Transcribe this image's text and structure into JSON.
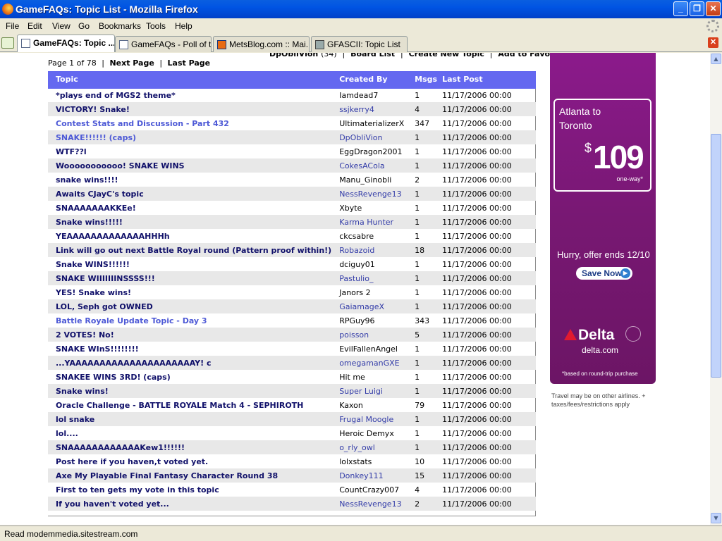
{
  "window": {
    "title": "GameFAQs: Topic List - Mozilla Firefox"
  },
  "menu": [
    "File",
    "Edit",
    "View",
    "Go",
    "Bookmarks",
    "Tools",
    "Help"
  ],
  "tabs": [
    {
      "label": "GameFAQs: Topic ...",
      "active": true
    },
    {
      "label": "GameFAQs - Poll of t...",
      "active": false
    },
    {
      "label": "MetsBlog.com :: Mai...",
      "active": false
    },
    {
      "label": "GFASCII: Topic List",
      "active": false
    }
  ],
  "top_nav": {
    "user": "DpObliVion",
    "karma": "(34)",
    "board_list": "Board List",
    "create_topic": "Create New Topic",
    "favorites": "Add to Favorites"
  },
  "pagination": {
    "page_text": "Page 1 of 78",
    "next": "Next Page",
    "last": "Last Page"
  },
  "table": {
    "headers": [
      "Topic",
      "Created By",
      "Msgs",
      "Last Post"
    ],
    "rows": [
      {
        "topic": "*plays end of MGS2 theme*",
        "by": "Iamdead7",
        "msgs": "1",
        "last": "11/17/2006 00:00",
        "visited": false
      },
      {
        "topic": "VICTORY! Snake!",
        "by": "ssjkerry4",
        "msgs": "4",
        "last": "11/17/2006 00:00",
        "visited": false
      },
      {
        "topic": "Contest Stats and Discussion - Part 432",
        "by": "UltimaterializerX",
        "msgs": "347",
        "last": "11/17/2006 00:00",
        "visited": true
      },
      {
        "topic": "SNAKE!!!!!! (caps)",
        "by": "DpObliVion",
        "msgs": "1",
        "last": "11/17/2006 00:00",
        "visited": true
      },
      {
        "topic": "WTF??l",
        "by": "EggDragon2001",
        "msgs": "1",
        "last": "11/17/2006 00:00",
        "visited": false
      },
      {
        "topic": "Wooooooooooo! SNAKE WINS",
        "by": "CokesACola",
        "msgs": "1",
        "last": "11/17/2006 00:00",
        "visited": false
      },
      {
        "topic": "snake wins!!!!",
        "by": "Manu_Ginobli",
        "msgs": "2",
        "last": "11/17/2006 00:00",
        "visited": false
      },
      {
        "topic": "Awaits CJayC's topic",
        "by": "NessRevenge13",
        "msgs": "1",
        "last": "11/17/2006 00:00",
        "visited": false
      },
      {
        "topic": "SNAAAAAAAKKEe!",
        "by": "Xbyte",
        "msgs": "1",
        "last": "11/17/2006 00:00",
        "visited": false
      },
      {
        "topic": "Snake wins!!!!!",
        "by": "Karma Hunter",
        "msgs": "1",
        "last": "11/17/2006 00:00",
        "visited": false
      },
      {
        "topic": "YEAAAAAAAAAAAAAHHHh",
        "by": "ckcsabre",
        "msgs": "1",
        "last": "11/17/2006 00:00",
        "visited": false
      },
      {
        "topic": "Link will go out next Battle Royal round (Pattern proof within!)",
        "by": "Robazoid",
        "msgs": "18",
        "last": "11/17/2006 00:00",
        "visited": false
      },
      {
        "topic": "Snake WINS!!!!!!",
        "by": "dciguy01",
        "msgs": "1",
        "last": "11/17/2006 00:00",
        "visited": false
      },
      {
        "topic": "SNAKE WIIIIIIINSSSS!!!",
        "by": "Pastulio_",
        "msgs": "1",
        "last": "11/17/2006 00:00",
        "visited": false
      },
      {
        "topic": "YES! Snake wins!",
        "by": "Janors 2",
        "msgs": "1",
        "last": "11/17/2006 00:00",
        "visited": false
      },
      {
        "topic": "LOL, Seph got OWNED",
        "by": "GaiamageX",
        "msgs": "1",
        "last": "11/17/2006 00:00",
        "visited": false
      },
      {
        "topic": "Battle Royale Update Topic - Day 3",
        "by": "RPGuy96",
        "msgs": "343",
        "last": "11/17/2006 00:00",
        "visited": true
      },
      {
        "topic": "2 VOTES! No!",
        "by": "poisson",
        "msgs": "5",
        "last": "11/17/2006 00:00",
        "visited": false
      },
      {
        "topic": "SNAKE WInS!!!!!!!!",
        "by": "EvilFallenAngel",
        "msgs": "1",
        "last": "11/17/2006 00:00",
        "visited": false
      },
      {
        "topic": "...YAAAAAAAAAAAAAAAAAAAAAY! c",
        "by": "omegamanGXE",
        "msgs": "1",
        "last": "11/17/2006 00:00",
        "visited": false
      },
      {
        "topic": "SNAKEE WINS 3RD! (caps)",
        "by": "Hit me",
        "msgs": "1",
        "last": "11/17/2006 00:00",
        "visited": false
      },
      {
        "topic": "Snake wins!",
        "by": "Super Luigi",
        "msgs": "1",
        "last": "11/17/2006 00:00",
        "visited": false
      },
      {
        "topic": "Oracle Challenge - BATTLE ROYALE Match 4 - SEPHIROTH",
        "by": "Kaxon",
        "msgs": "79",
        "last": "11/17/2006 00:00",
        "visited": false
      },
      {
        "topic": "lol snake",
        "by": "Frugal Moogle",
        "msgs": "1",
        "last": "11/17/2006 00:00",
        "visited": false
      },
      {
        "topic": "lol....",
        "by": "Heroic Demyx",
        "msgs": "1",
        "last": "11/17/2006 00:00",
        "visited": false
      },
      {
        "topic": "SNAAAAAAAAAAAAKew1!!!!!!",
        "by": "o_rly_owl",
        "msgs": "1",
        "last": "11/17/2006 00:00",
        "visited": false
      },
      {
        "topic": "Post here if you haven,t voted yet.",
        "by": "lolxstats",
        "msgs": "10",
        "last": "11/17/2006 00:00",
        "visited": false
      },
      {
        "topic": "Axe My Playable Final Fantasy Character Round 38",
        "by": "Donkey111",
        "msgs": "15",
        "last": "11/17/2006 00:00",
        "visited": false
      },
      {
        "topic": "First to ten gets my vote in this topic",
        "by": "CountCrazy007",
        "msgs": "4",
        "last": "11/17/2006 00:00",
        "visited": false
      },
      {
        "topic": "If you haven't voted yet...",
        "by": "NessRevenge13",
        "msgs": "2",
        "last": "11/17/2006 00:00",
        "visited": false
      }
    ]
  },
  "ad": {
    "dest_line1": "Atlanta to",
    "dest_line2": "Toronto",
    "currency": "$",
    "price": "109",
    "one_way": "one-way*",
    "hurry": "Hurry, offer ends 12/10",
    "cta": "Save Now",
    "brand": "Delta",
    "url": "delta.com",
    "fine_print": "*based on round-trip purchase",
    "note": "Travel may be on other airlines. + taxes/fees/restrictions apply"
  },
  "status": "Read modemmedia.sitestream.com",
  "colors": {
    "header_bg": "#6468f0",
    "ad_bg": "#7a1876",
    "visited_link": "#4d59d6"
  }
}
